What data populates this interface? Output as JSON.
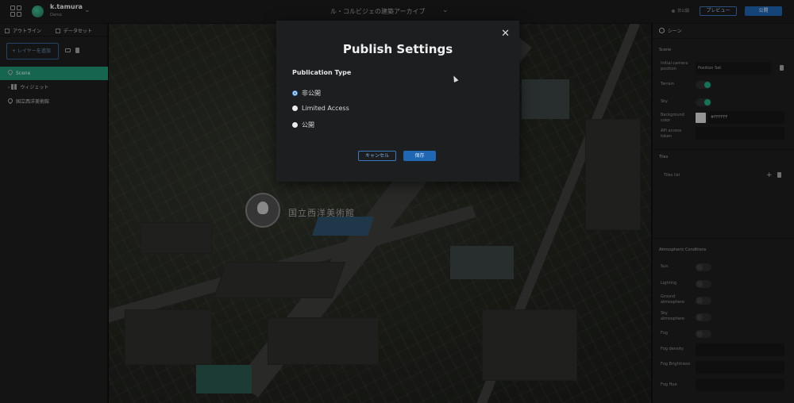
{
  "header": {
    "username": "k.tamura",
    "workspace_sub": "Demo",
    "project_title": "ル・コルビジェの建築アーカイブ",
    "status_text": "非公開",
    "preview_label": "プレビュー",
    "publish_label": "公開"
  },
  "left_panel": {
    "tabs": [
      {
        "label": "アウトライン"
      },
      {
        "label": "データセット"
      }
    ],
    "add_layer_label": "+ レイヤーを追加",
    "items": [
      {
        "label": "Scene"
      },
      {
        "label": "ウィジェット"
      },
      {
        "label": "国立西洋美術館"
      }
    ]
  },
  "map": {
    "marker_label": "国立西洋美術館"
  },
  "right_panel": {
    "tab_label": "シーン",
    "scene_section": "Scene",
    "initial_camera_label": "Initial camera position",
    "initial_camera_value": "Position Set",
    "terrain_label": "Terrain",
    "sky_label": "Sky",
    "bg_color_label": "Background color",
    "bg_color_value": "#FFFFFF",
    "api_label": "API access token",
    "tiles_section": "Tiles",
    "tiles_list_label": "Tiles list",
    "add_icon": "+",
    "atmos_section": "Atmospheric Conditions",
    "atmos_items": [
      {
        "label": "Sun"
      },
      {
        "label": "Lighting"
      },
      {
        "label": "Ground atmosphere"
      },
      {
        "label": "Sky atmosphere"
      },
      {
        "label": "Fog"
      },
      {
        "label": "Fog density"
      },
      {
        "label": "Fog Brightness"
      },
      {
        "label": "Fog Hue"
      }
    ]
  },
  "modal": {
    "close_icon": "✕",
    "title": "Publish Settings",
    "publication_type_label": "Publication Type",
    "options": [
      {
        "label": "非公開",
        "checked": true
      },
      {
        "label": "Limited Access",
        "checked": false
      },
      {
        "label": "公開",
        "checked": false
      }
    ],
    "cancel_label": "キャンセル",
    "save_label": "保存"
  },
  "colors": {
    "accent_green": "#1f8c6d",
    "accent_blue": "#1e5fa8",
    "modal_bg": "#1d1e20"
  }
}
